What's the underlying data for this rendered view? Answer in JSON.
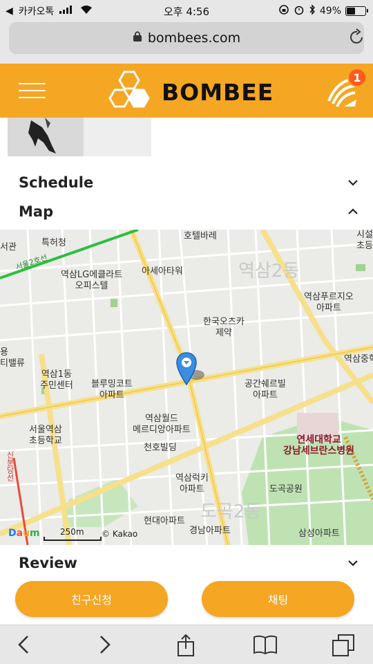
{
  "status_bar": {
    "carrier": "카카오톡",
    "time": "오후 4:56",
    "battery_percent": "49%",
    "battery_level": 0.49
  },
  "browser": {
    "url": "bombees.com"
  },
  "header": {
    "brand": "BOMBEE",
    "notification_count": "1",
    "accent_color": "#f5a623",
    "badge_color": "#ff5a1f"
  },
  "sections": {
    "schedule": "Schedule",
    "map": "Map",
    "review": "Review"
  },
  "map": {
    "labels": {
      "l1": "특허청",
      "l2": "호텔바레",
      "l3": "역삼LG에클라트",
      "l3b": "오피스텔",
      "l4": "아세아타워",
      "l5": "서울2호선",
      "l6": "역삼푸르지오",
      "l6b": "아파트",
      "l7": "한국오츠카",
      "l7b": "제약",
      "l8": "역삼1동",
      "l8b": "주민센터",
      "l9": "블루밍코트",
      "l9b": "아파트",
      "l10": "공간쉐르빌",
      "l10b": "아파트",
      "l11": "역삼월드",
      "l11b": "메르디앙아파트",
      "l12": "서울역삼",
      "l12b": "초등학교",
      "l13": "천호빌딩",
      "l14": "연세대학교",
      "l14b": "강남세브란스병원",
      "l15": "역삼럭키",
      "l15b": "아파트",
      "l16": "도곡공원",
      "l17": "현대아파트",
      "l18": "경남아파트",
      "l19": "삼성아파트",
      "l20": "신분당선",
      "l21": "역삼중학",
      "l22": "서관",
      "l23": "시설",
      "l23b": "초등",
      "l24": "용",
      "l24b": "티밸류",
      "l25": "역삼2동",
      "l26": "도곡2동"
    },
    "scale": "250m",
    "attribution": "© Kakao",
    "logo": "Daum"
  },
  "buttons": {
    "friend_request": "친구신청",
    "chat": "채팅"
  }
}
